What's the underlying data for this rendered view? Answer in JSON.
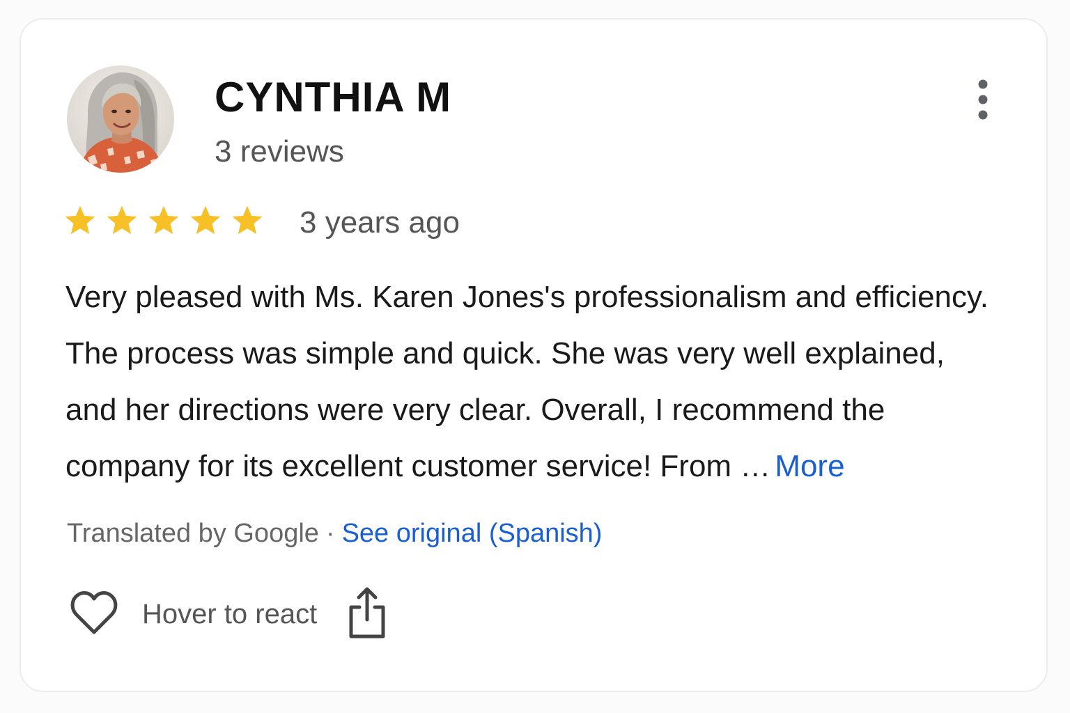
{
  "review": {
    "author_name": "CYNTHIA M",
    "review_count": "3 reviews",
    "rating": 5,
    "rating_max": 5,
    "time_ago": "3 years ago",
    "text_lines": [
      "Very pleased with Ms. Karen Jones's professionalism and efficiency.",
      "The process was simple and quick. She was very well explained,",
      "and her directions were very clear. Overall, I recommend the",
      "company for its excellent customer service! From …"
    ],
    "more_label": "More"
  },
  "translation": {
    "translated_by": "Translated by Google",
    "separator": "·",
    "see_original": "See original (Spanish)"
  },
  "actions": {
    "react_label": "Hover to react",
    "heart_icon": "heart-icon",
    "share_icon": "share-icon",
    "more_options_icon": "more-vert-icon"
  },
  "colors": {
    "star": "#F6C026",
    "link": "#1A5FD0",
    "text_primary": "#1A1A1A",
    "text_secondary": "#555555"
  }
}
